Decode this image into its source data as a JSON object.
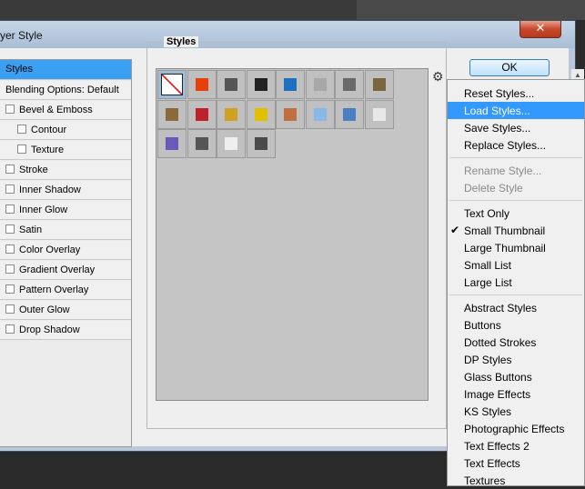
{
  "window": {
    "title": "yer Style",
    "close_glyph": "✕"
  },
  "ok_label": "OK",
  "left_panel": [
    {
      "label": "Styles",
      "selected": true,
      "checkbox": false,
      "indent": 0
    },
    {
      "label": "Blending Options: Default",
      "selected": false,
      "checkbox": false,
      "indent": 0
    },
    {
      "label": "Bevel & Emboss",
      "checkbox": true,
      "indent": 0
    },
    {
      "label": "Contour",
      "checkbox": true,
      "indent": 1
    },
    {
      "label": "Texture",
      "checkbox": true,
      "indent": 1
    },
    {
      "label": "Stroke",
      "checkbox": true,
      "indent": 0
    },
    {
      "label": "Inner Shadow",
      "checkbox": true,
      "indent": 0
    },
    {
      "label": "Inner Glow",
      "checkbox": true,
      "indent": 0
    },
    {
      "label": "Satin",
      "checkbox": true,
      "indent": 0
    },
    {
      "label": "Color Overlay",
      "checkbox": true,
      "indent": 0
    },
    {
      "label": "Gradient Overlay",
      "checkbox": true,
      "indent": 0
    },
    {
      "label": "Pattern Overlay",
      "checkbox": true,
      "indent": 0
    },
    {
      "label": "Outer Glow",
      "checkbox": true,
      "indent": 0
    },
    {
      "label": "Drop Shadow",
      "checkbox": true,
      "indent": 0
    }
  ],
  "styles_group": {
    "label": "Styles"
  },
  "swatches": [
    {
      "icon": "no-style-icon",
      "color": "#ffffff"
    },
    {
      "icon": "orange-glow-icon",
      "color": "#e8400c"
    },
    {
      "icon": "white-frame-icon",
      "color": "#555555"
    },
    {
      "icon": "camera-icon",
      "color": "#222222"
    },
    {
      "icon": "blue-square-icon",
      "color": "#1f6fc0"
    },
    {
      "icon": "gray-square-icon",
      "color": "#a8a8a8"
    },
    {
      "icon": "chrome-icon",
      "color": "#6a6a6a"
    },
    {
      "icon": "brown-square-icon",
      "color": "#7a6640"
    },
    {
      "icon": "bronze-square-icon",
      "color": "#8a6a3a"
    },
    {
      "icon": "red-stripes-icon",
      "color": "#c0202a"
    },
    {
      "icon": "rainbow-icon",
      "color": "#d0a020"
    },
    {
      "icon": "yellow-frame-icon",
      "color": "#e0c000"
    },
    {
      "icon": "copper-icon",
      "color": "#c07040"
    },
    {
      "icon": "light-blue-icon",
      "color": "#8ab8e8"
    },
    {
      "icon": "sunset-icon",
      "color": "#4a80c0"
    },
    {
      "icon": "sparkle-icon",
      "color": "#e8e8e8"
    },
    {
      "icon": "purple-square-icon",
      "color": "#6a5ab8"
    },
    {
      "icon": "dark-gray-icon",
      "color": "#555555"
    },
    {
      "icon": "white-square-icon",
      "color": "#eeeeee"
    },
    {
      "icon": "dark-square-icon",
      "color": "#4a4a4a"
    }
  ],
  "menu": [
    {
      "label": "Reset Styles...",
      "state": "normal"
    },
    {
      "label": "Load Styles...",
      "state": "highlighted"
    },
    {
      "label": "Save Styles...",
      "state": "normal"
    },
    {
      "label": "Replace Styles...",
      "state": "normal"
    },
    {
      "sep": true
    },
    {
      "label": "Rename Style...",
      "state": "disabled"
    },
    {
      "label": "Delete Style",
      "state": "disabled"
    },
    {
      "sep": true
    },
    {
      "label": "Text Only",
      "state": "normal"
    },
    {
      "label": "Small Thumbnail",
      "state": "checked"
    },
    {
      "label": "Large Thumbnail",
      "state": "normal"
    },
    {
      "label": "Small List",
      "state": "normal"
    },
    {
      "label": "Large List",
      "state": "normal"
    },
    {
      "sep": true
    },
    {
      "label": "Abstract Styles",
      "state": "normal"
    },
    {
      "label": "Buttons",
      "state": "normal"
    },
    {
      "label": "Dotted Strokes",
      "state": "normal"
    },
    {
      "label": "DP Styles",
      "state": "normal"
    },
    {
      "label": "Glass Buttons",
      "state": "normal"
    },
    {
      "label": "Image Effects",
      "state": "normal"
    },
    {
      "label": "KS Styles",
      "state": "normal"
    },
    {
      "label": "Photographic Effects",
      "state": "normal"
    },
    {
      "label": "Text Effects 2",
      "state": "normal"
    },
    {
      "label": "Text Effects",
      "state": "normal"
    },
    {
      "label": "Textures",
      "state": "normal"
    }
  ],
  "colors": {
    "selection": "#3b9ff2",
    "menu_highlight": "#3399ff"
  }
}
